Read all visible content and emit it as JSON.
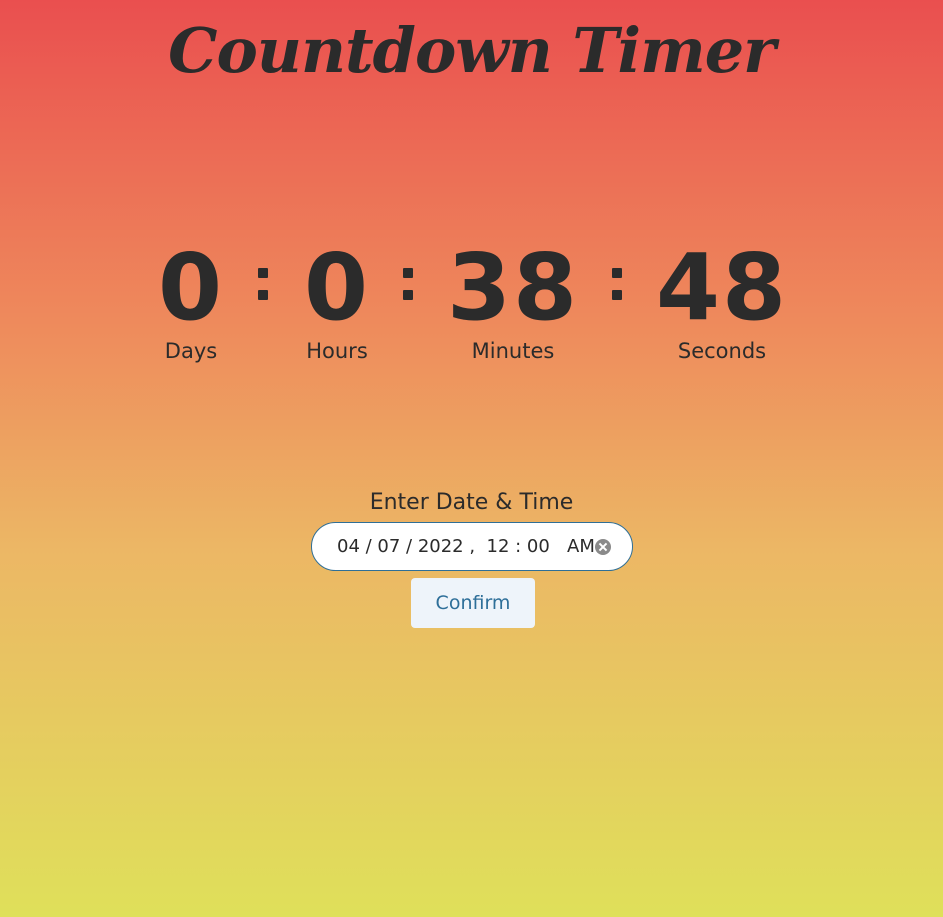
{
  "app": {
    "title": "Countdown Timer"
  },
  "countdown": {
    "days": {
      "value": "0",
      "label": "Days"
    },
    "hours": {
      "value": "0",
      "label": "Hours"
    },
    "minutes": {
      "value": "38",
      "label": "Minutes"
    },
    "seconds": {
      "value": "48",
      "label": "Seconds"
    }
  },
  "form": {
    "label": "Enter Date & Time",
    "datetime_value": "04/07/2022, 12:00  AM",
    "datetime_display": "04 / 07 / 2022 ,  12 : 00   AM",
    "clear_icon": "clear-icon",
    "confirm_label": "Confirm"
  },
  "colors": {
    "gradient_top": "#ea4f4f",
    "gradient_bottom": "#dfe05a",
    "text": "#2b2b2b",
    "button_text": "#2e6f99",
    "button_bg": "#eef4fa",
    "input_border": "#2f6f97"
  }
}
